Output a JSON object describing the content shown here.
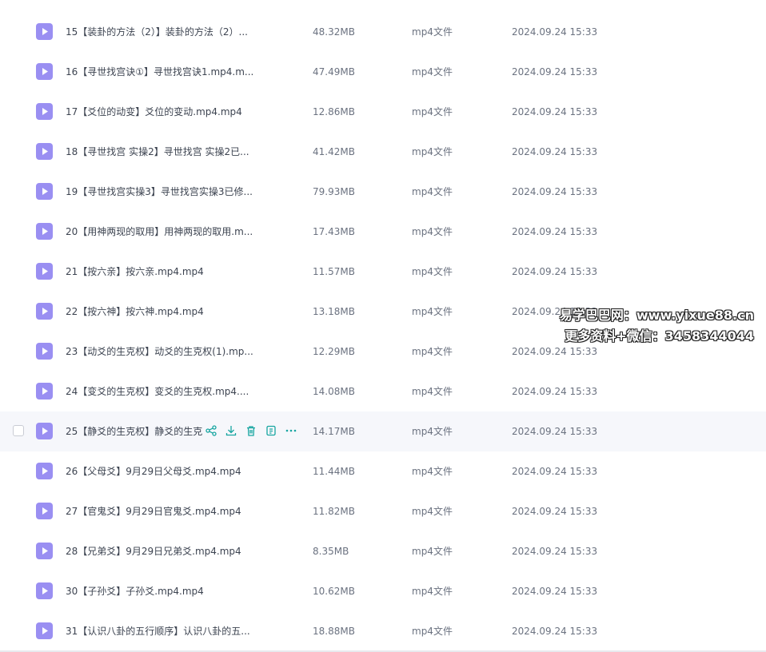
{
  "files": [
    {
      "name": "15【装卦的方法（2）】装卦的方法（2）...",
      "size": "48.32MB",
      "type": "mp4文件",
      "time": "2024.09.24 15:33"
    },
    {
      "name": "16【寻世找宫诀①】寻世找宫诀1.mp4.m...",
      "size": "47.49MB",
      "type": "mp4文件",
      "time": "2024.09.24 15:33"
    },
    {
      "name": "17【爻位的动变】爻位的变动.mp4.mp4",
      "size": "12.86MB",
      "type": "mp4文件",
      "time": "2024.09.24 15:33"
    },
    {
      "name": "18【寻世找宫 实操2】寻世找宫 实操2已...",
      "size": "41.42MB",
      "type": "mp4文件",
      "time": "2024.09.24 15:33"
    },
    {
      "name": "19【寻世找宫实操3】寻世找宫实操3已修...",
      "size": "79.93MB",
      "type": "mp4文件",
      "time": "2024.09.24 15:33"
    },
    {
      "name": "20【用神两现的取用】用神两现的取用.m...",
      "size": "17.43MB",
      "type": "mp4文件",
      "time": "2024.09.24 15:33"
    },
    {
      "name": "21【按六亲】按六亲.mp4.mp4",
      "size": "11.57MB",
      "type": "mp4文件",
      "time": "2024.09.24 15:33"
    },
    {
      "name": "22【按六神】按六神.mp4.mp4",
      "size": "13.18MB",
      "type": "mp4文件",
      "time": "2024.09.24 15:33"
    },
    {
      "name": "23【动爻的生克权】动爻的生克权(1).mp...",
      "size": "12.29MB",
      "type": "mp4文件",
      "time": "2024.09.24 15:33"
    },
    {
      "name": "24【变爻的生克权】变爻的生克权.mp4....",
      "size": "14.08MB",
      "type": "mp4文件",
      "time": "2024.09.24 15:33"
    },
    {
      "name": "25【静爻的生克权】静爻的生克",
      "size": "14.17MB",
      "type": "mp4文件",
      "time": "2024.09.24 15:33"
    },
    {
      "name": "26【父母爻】9月29日父母爻.mp4.mp4",
      "size": "11.44MB",
      "type": "mp4文件",
      "time": "2024.09.24 15:33"
    },
    {
      "name": "27【官鬼爻】9月29日官鬼爻.mp4.mp4",
      "size": "11.82MB",
      "type": "mp4文件",
      "time": "2024.09.24 15:33"
    },
    {
      "name": "28【兄弟爻】9月29日兄弟爻.mp4.mp4",
      "size": "8.35MB",
      "type": "mp4文件",
      "time": "2024.09.24 15:33"
    },
    {
      "name": "30【子孙爻】子孙爻.mp4.mp4",
      "size": "10.62MB",
      "type": "mp4文件",
      "time": "2024.09.24 15:33"
    },
    {
      "name": "31【认识八卦的五行顺序】认识八卦的五...",
      "size": "18.88MB",
      "type": "mp4文件",
      "time": "2024.09.24 15:33"
    }
  ],
  "hover_row_index": 10,
  "row_actions": [
    "share-icon",
    "download-icon",
    "delete-icon",
    "info-icon",
    "more-icon"
  ],
  "watermark": {
    "line1": "易学巴巴网：www.yixue88.cn",
    "line2": "更多资料+微信：3458344044"
  },
  "colors": {
    "file_icon": "#9a8ff2",
    "action_icon": "#16a5a0",
    "hover_background": "#f6f7fb"
  }
}
